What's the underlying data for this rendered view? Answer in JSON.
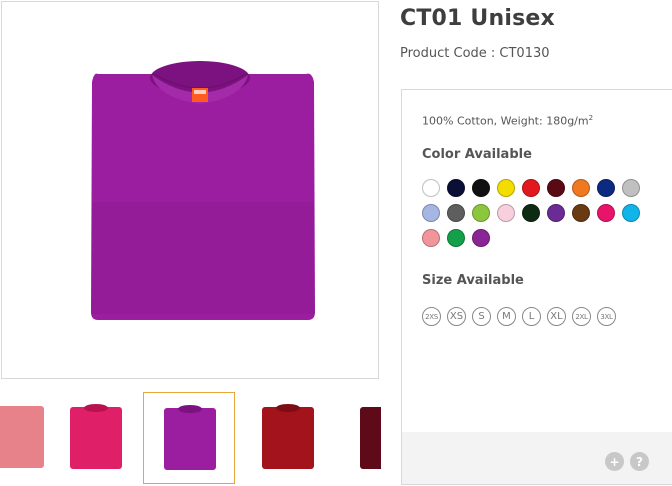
{
  "product": {
    "title": "CT01 Unisex",
    "code": "Product Code : CT0130",
    "spec_text": "100% Cotton, Weight: 180g/m",
    "spec_sup": "2",
    "main_color": "#9b1ea0"
  },
  "colors_title": "Color Available",
  "colors": [
    "#ffffff",
    "#0a0f35",
    "#111111",
    "#f3dd00",
    "#e1191f",
    "#5a0a14",
    "#f07820",
    "#0b2a80",
    "#c0c0c0",
    "#a6b6e2",
    "#5e5e5e",
    "#8cc63f",
    "#f8cfdc",
    "#0d2a12",
    "#6a2b94",
    "#6a3b12",
    "#e8146a",
    "#11b4e8",
    "#f0969a",
    "#12a04a",
    "#8a2596"
  ],
  "sizes_title": "Size Available",
  "sizes": [
    "2XS",
    "XS",
    "S",
    "M",
    "L",
    "XL",
    "2XL",
    "3XL"
  ],
  "thumbnails": [
    {
      "color": "#e8828a"
    },
    {
      "color": "#df1f67"
    },
    {
      "color": "#9b1ea0"
    },
    {
      "color": "#a3131b"
    },
    {
      "color": "#5e0a18"
    }
  ],
  "footer_buttons": {
    "zoom": "+",
    "help": "?"
  }
}
